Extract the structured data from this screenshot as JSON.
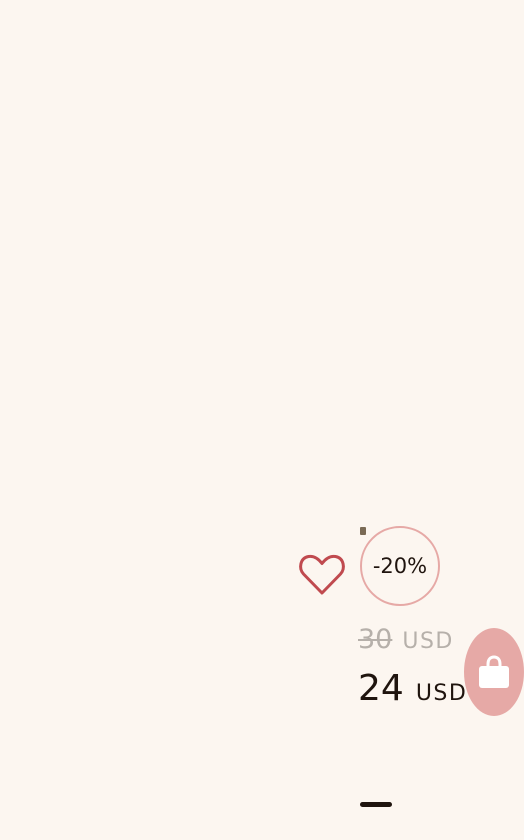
{
  "product": {
    "discount_label": "-20%",
    "old_price": {
      "amount": "30",
      "currency": "USD"
    },
    "new_price": {
      "amount": "24",
      "currency": "USD"
    }
  },
  "icons": {
    "wishlist": "heart-icon",
    "cart": "shopping-bag-icon"
  },
  "colors": {
    "background": "#fcf6f0",
    "accent": "#e6a9a6",
    "heart": "#c04a4f",
    "text": "#1f140e",
    "muted_text": "#b6b0aa"
  }
}
